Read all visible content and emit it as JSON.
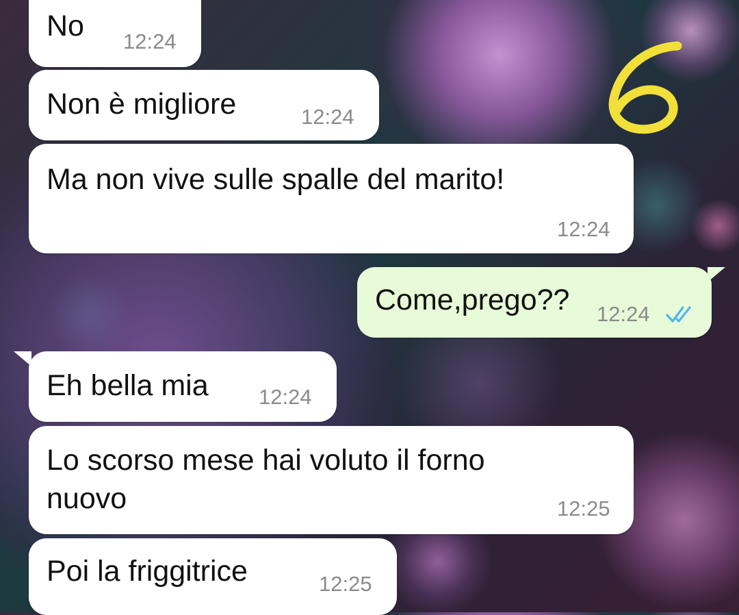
{
  "annotation": {
    "number": "6",
    "color": "#f2e03a"
  },
  "colors": {
    "incoming_bubble": "#ffffff",
    "outgoing_bubble": "#e7fbd8",
    "read_ticks": "#4fb6ec"
  },
  "messages": [
    {
      "direction": "in",
      "text": "No",
      "time": "12:24"
    },
    {
      "direction": "in",
      "text": "Non è migliore",
      "time": "12:24"
    },
    {
      "direction": "in",
      "text": "Ma non vive sulle spalle del marito!",
      "time": "12:24"
    },
    {
      "direction": "out",
      "text": "Come,prego??",
      "time": "12:24",
      "status_icon": "double-check-read-icon"
    },
    {
      "direction": "in",
      "text": "Eh bella mia",
      "time": "12:24"
    },
    {
      "direction": "in",
      "text": "Lo scorso mese hai voluto il forno\nnuovo",
      "time": "12:25"
    },
    {
      "direction": "in",
      "text": "Poi la friggitrice",
      "time": "12:25"
    }
  ]
}
